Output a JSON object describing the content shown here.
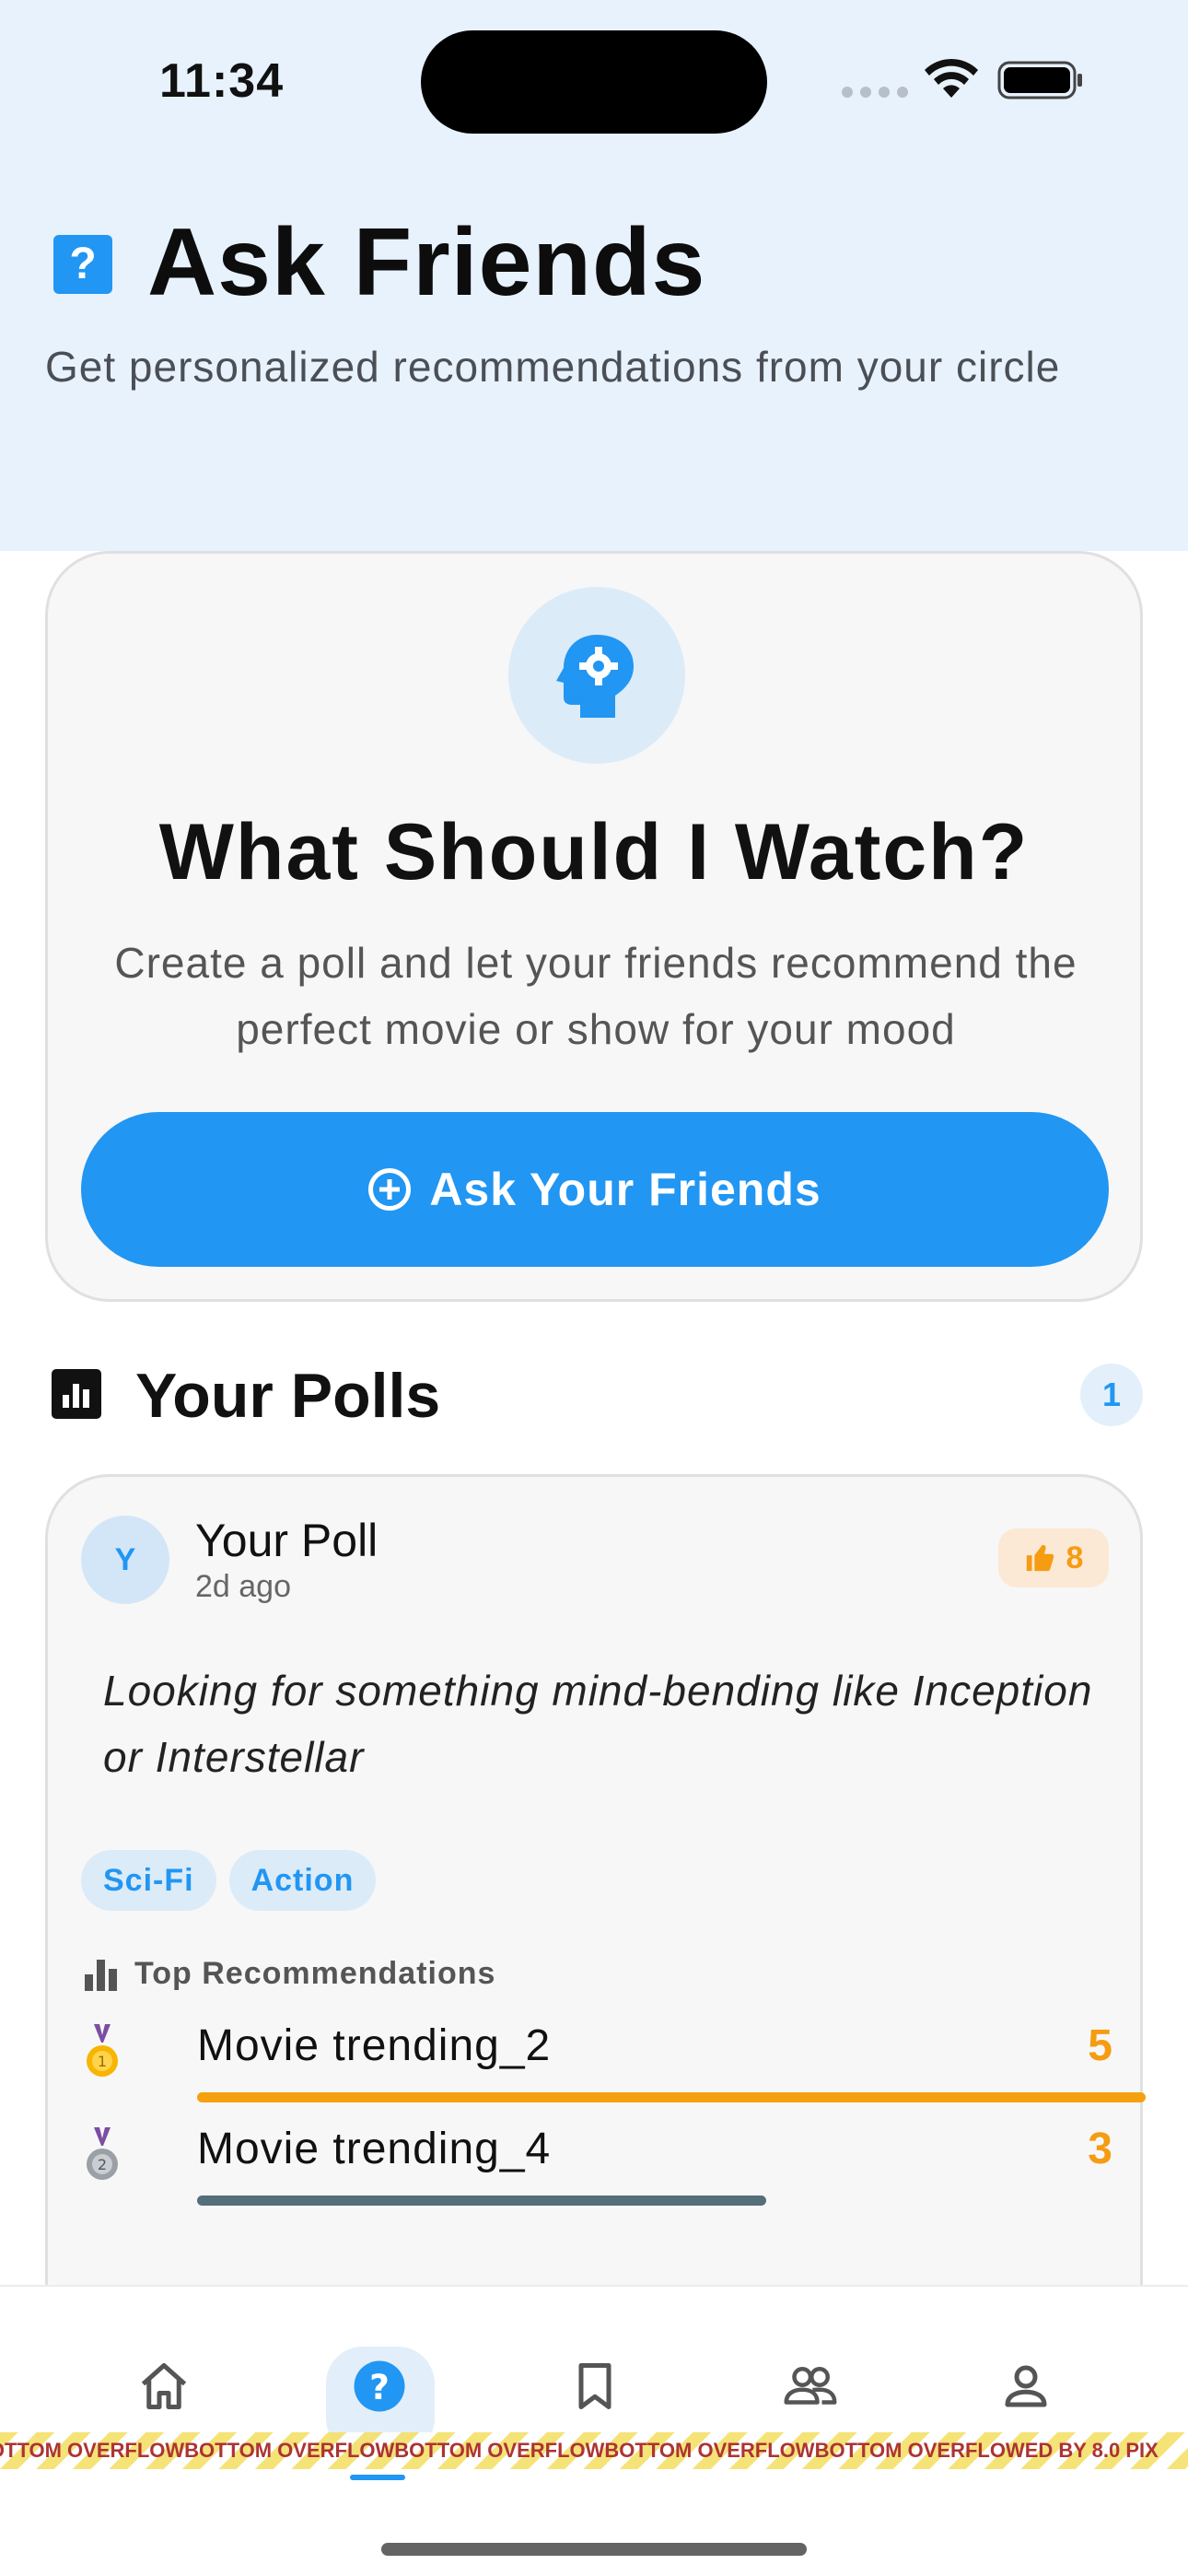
{
  "status_bar": {
    "time": "11:34"
  },
  "header": {
    "title": "Ask Friends",
    "subtitle": "Get personalized recommendations from your circle"
  },
  "hero": {
    "title": "What Should I Watch?",
    "description": "Create a poll and let your friends recommend the perfect movie or show for your mood",
    "button_label": "Ask Your Friends"
  },
  "polls_section": {
    "title": "Your Polls",
    "count": "1"
  },
  "poll": {
    "avatar_initial": "Y",
    "author": "Your Poll",
    "time": "2d ago",
    "likes": "8",
    "question": "Looking for something mind-bending like Inception or Interstellar",
    "tags": [
      "Sci-Fi",
      "Action"
    ],
    "recommendations_label": "Top Recommendations",
    "recommendations": [
      {
        "title": "Movie trending_2",
        "votes": "5",
        "share": 1.0,
        "bar_color": "#f5a10f"
      },
      {
        "title": "Movie trending_4",
        "votes": "3",
        "share": 0.6,
        "bar_color": "#546e7a"
      }
    ]
  },
  "overflow_banner": {
    "segments": [
      "BOTTOM OVERFLOW",
      "BOTTOM OVERFLOW",
      "BOTTOM OVERFLOW",
      "BOTTOM OVERFLOW",
      "BOTTOM OVERFLOWED BY 8.0 PIX"
    ]
  },
  "nav": {
    "items": [
      {
        "icon": "home-icon",
        "active": false
      },
      {
        "icon": "help-icon",
        "active": true
      },
      {
        "icon": "bookmark-icon",
        "active": false
      },
      {
        "icon": "friends-icon",
        "active": false
      },
      {
        "icon": "profile-icon",
        "active": false
      }
    ]
  },
  "colors": {
    "accent": "#2196f3",
    "header_bg": "#e7f2fd",
    "vote": "#f59c12",
    "overflow_text": "#a51d1d"
  }
}
